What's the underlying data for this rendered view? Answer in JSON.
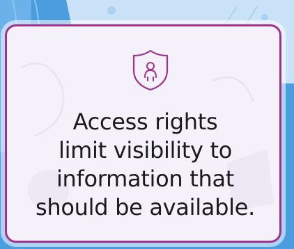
{
  "card": {
    "icon": "shield-person-icon",
    "lines": [
      "Access rights",
      "limit visibility to",
      "information that",
      "should be available."
    ]
  },
  "colors": {
    "background": "#4a9ee0",
    "card_border": "#a3308b",
    "card_fill": "#f5f1fa",
    "text": "#1a1a1a"
  }
}
